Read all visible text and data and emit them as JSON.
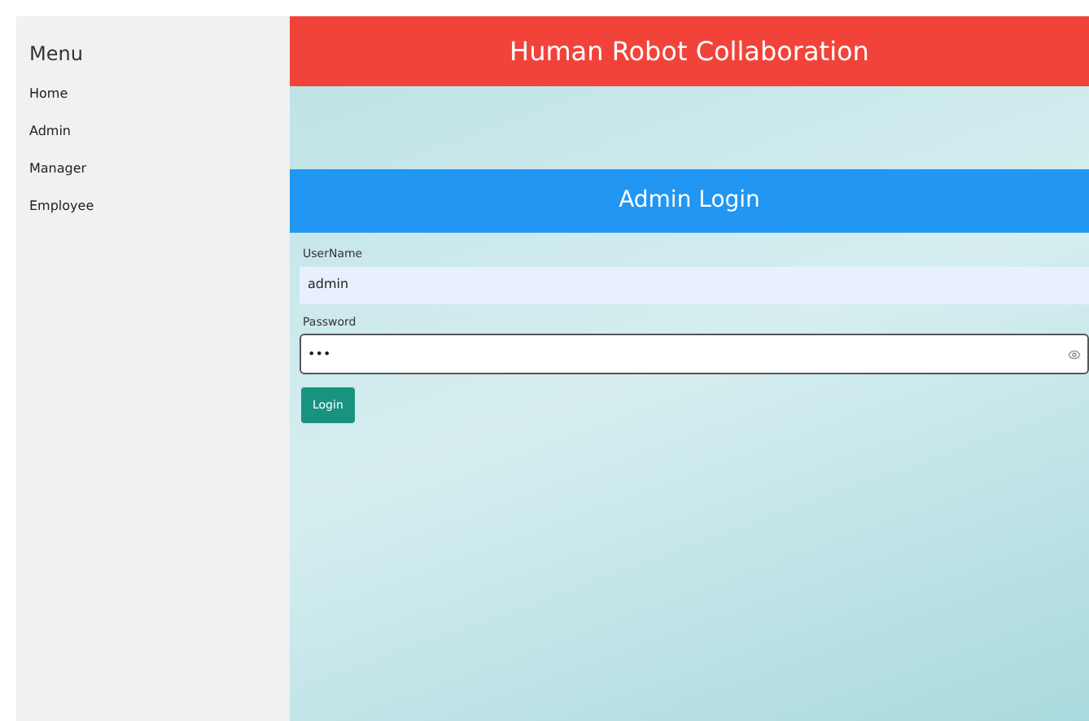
{
  "sidebar": {
    "title": "Menu",
    "items": [
      {
        "label": "Home"
      },
      {
        "label": "Admin"
      },
      {
        "label": "Manager"
      },
      {
        "label": "Employee"
      }
    ]
  },
  "header": {
    "title": "Human Robot Collaboration"
  },
  "login": {
    "title": "Admin Login",
    "fields": [
      {
        "label": "UserName",
        "value": "admin",
        "focused": false
      },
      {
        "label": "Password",
        "value": "•••",
        "focused": true
      }
    ],
    "button": "Login"
  }
}
